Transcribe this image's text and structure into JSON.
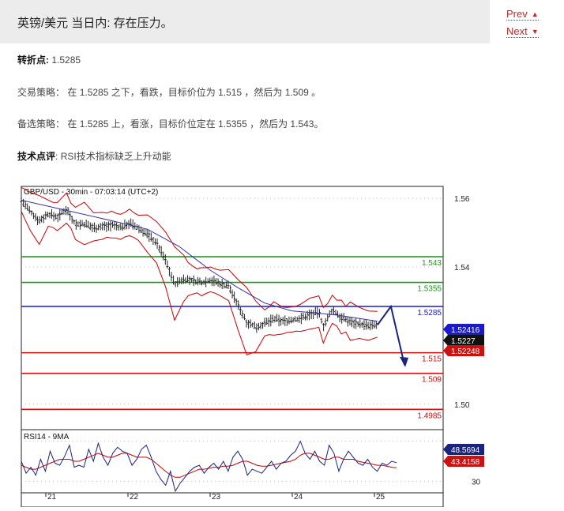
{
  "header": {
    "title": "英镑/美元 当日内: 存在压力。",
    "prev_label": "Prev",
    "next_label": "Next"
  },
  "content": {
    "pivot_label": "转折点:",
    "pivot_value": "1.5285",
    "strategy_label": "交易策略：",
    "strategy_text": "在 1.5285 之下，看跌，目标价位为 1.515 ，然后为 1.509 。",
    "alternative_label": "备选策略：",
    "alternative_text": "在 1.5285 上，看涨，目标价位定在 1.5355 ，然后为 1.543。",
    "comment_label": "技术点评",
    "comment_text": "RSI技术指标缺乏上升动能"
  },
  "colors": {
    "resistance": "#1a9a1a",
    "pivot": "#1a1acc",
    "support": "#cc1111",
    "bollinger": "#cc0000",
    "moving_average": "#3333aa",
    "candles": "#222222",
    "rsi_ma": "#cc0000"
  },
  "chart_data": {
    "type": "line",
    "title": "GBP/USD - 30min - 07:03:14 (UTC+2)",
    "y_ticks": [
      "1.56",
      "1.54",
      "1.50"
    ],
    "ylim": [
      1.4935,
      1.5635
    ],
    "x_ticks": [
      "21",
      "22",
      "23",
      "24",
      "25"
    ],
    "levels": [
      {
        "label": "1.543",
        "value": 1.543,
        "kind": "resistance"
      },
      {
        "label": "1.5355",
        "value": 1.5355,
        "kind": "resistance"
      },
      {
        "label": "1.5285",
        "value": 1.5285,
        "kind": "pivot"
      },
      {
        "label": "1.515",
        "value": 1.515,
        "kind": "support"
      },
      {
        "label": "1.509",
        "value": 1.509,
        "kind": "support"
      },
      {
        "label": "1.4985",
        "value": 1.4985,
        "kind": "support"
      }
    ],
    "price_badges": [
      {
        "label": "1.52416",
        "value": 1.52416,
        "color": "#1a1acc"
      },
      {
        "label": "1.5227",
        "value": 1.5227,
        "color": "#111111"
      },
      {
        "label": "1.52248",
        "value": 1.52248,
        "color": "#cc1111"
      }
    ],
    "price_series": [
      {
        "x": 0,
        "y": 1.5595
      },
      {
        "x": 4,
        "y": 1.556
      },
      {
        "x": 8,
        "y": 1.5535
      },
      {
        "x": 12,
        "y": 1.5555
      },
      {
        "x": 16,
        "y": 1.5545
      },
      {
        "x": 20,
        "y": 1.557
      },
      {
        "x": 24,
        "y": 1.5525
      },
      {
        "x": 28,
        "y": 1.5525
      },
      {
        "x": 32,
        "y": 1.5515
      },
      {
        "x": 36,
        "y": 1.5518
      },
      {
        "x": 40,
        "y": 1.5522
      },
      {
        "x": 44,
        "y": 1.5515
      },
      {
        "x": 48,
        "y": 1.5528
      },
      {
        "x": 52,
        "y": 1.5512
      },
      {
        "x": 56,
        "y": 1.5495
      },
      {
        "x": 60,
        "y": 1.547
      },
      {
        "x": 64,
        "y": 1.542
      },
      {
        "x": 68,
        "y": 1.535
      },
      {
        "x": 72,
        "y": 1.5365
      },
      {
        "x": 76,
        "y": 1.536
      },
      {
        "x": 80,
        "y": 1.5355
      },
      {
        "x": 84,
        "y": 1.5362
      },
      {
        "x": 88,
        "y": 1.5352
      },
      {
        "x": 92,
        "y": 1.5345
      },
      {
        "x": 96,
        "y": 1.529
      },
      {
        "x": 100,
        "y": 1.524
      },
      {
        "x": 104,
        "y": 1.5225
      },
      {
        "x": 108,
        "y": 1.5235
      },
      {
        "x": 112,
        "y": 1.5248
      },
      {
        "x": 116,
        "y": 1.5242
      },
      {
        "x": 120,
        "y": 1.5245
      },
      {
        "x": 124,
        "y": 1.525
      },
      {
        "x": 128,
        "y": 1.5262
      },
      {
        "x": 132,
        "y": 1.5268
      },
      {
        "x": 134,
        "y": 1.5228
      },
      {
        "x": 136,
        "y": 1.525
      },
      {
        "x": 138,
        "y": 1.5275
      },
      {
        "x": 142,
        "y": 1.5252
      },
      {
        "x": 146,
        "y": 1.524
      },
      {
        "x": 150,
        "y": 1.5235
      },
      {
        "x": 154,
        "y": 1.5227
      },
      {
        "x": 158,
        "y": 1.5231
      }
    ],
    "ma_series": [
      {
        "x": 0,
        "y": 1.5595
      },
      {
        "x": 20,
        "y": 1.5565
      },
      {
        "x": 40,
        "y": 1.5535
      },
      {
        "x": 56,
        "y": 1.551
      },
      {
        "x": 70,
        "y": 1.546
      },
      {
        "x": 84,
        "y": 1.539
      },
      {
        "x": 96,
        "y": 1.534
      },
      {
        "x": 108,
        "y": 1.5295
      },
      {
        "x": 120,
        "y": 1.5272
      },
      {
        "x": 140,
        "y": 1.526
      },
      {
        "x": 158,
        "y": 1.52416
      }
    ],
    "forecast": [
      {
        "x": 158,
        "y": 1.5231
      },
      {
        "x": 164,
        "y": 1.5285
      },
      {
        "x": 170,
        "y": 1.5115
      }
    ],
    "rsi": {
      "label": "RSI14 - 9MA",
      "rsi_value_label": "48.5694",
      "ma_value_label": "43.4158",
      "tick_label": "30",
      "rsi_value": 48.5694,
      "ma_value": 43.4158,
      "ylim": [
        20,
        80
      ],
      "rsi_series": [
        50,
        38,
        44,
        36,
        52,
        40,
        60,
        48,
        46,
        55,
        66,
        44,
        46,
        44,
        62,
        50,
        68,
        54,
        46,
        58,
        64,
        60,
        58,
        46,
        52,
        62,
        66,
        54,
        40,
        32,
        26,
        40,
        20,
        28,
        34,
        40,
        44,
        46,
        38,
        44,
        48,
        42,
        50,
        40,
        54,
        60,
        52,
        36,
        42,
        40,
        38,
        44,
        50,
        42,
        48,
        50,
        56,
        60,
        70,
        58,
        52,
        60,
        50,
        46,
        66,
        58,
        40,
        52,
        60,
        54,
        48,
        46,
        52,
        44,
        40,
        48,
        46,
        50,
        48.57
      ],
      "ma_series": [
        46,
        44,
        42,
        42,
        44,
        46,
        48,
        50,
        52,
        52,
        52,
        50,
        50,
        52,
        54,
        56,
        58,
        56,
        54,
        54,
        56,
        58,
        58,
        56,
        54,
        54,
        54,
        52,
        48,
        44,
        40,
        36,
        34,
        34,
        36,
        38,
        40,
        42,
        42,
        43,
        44,
        44,
        45,
        45,
        46,
        48,
        50,
        50,
        48,
        46,
        45,
        45,
        46,
        47,
        48,
        49,
        50,
        52,
        56,
        58,
        58,
        56,
        54,
        52,
        52,
        54,
        54,
        52,
        52,
        52,
        50,
        49,
        48,
        47,
        46,
        46,
        45,
        44,
        43.42
      ]
    }
  }
}
